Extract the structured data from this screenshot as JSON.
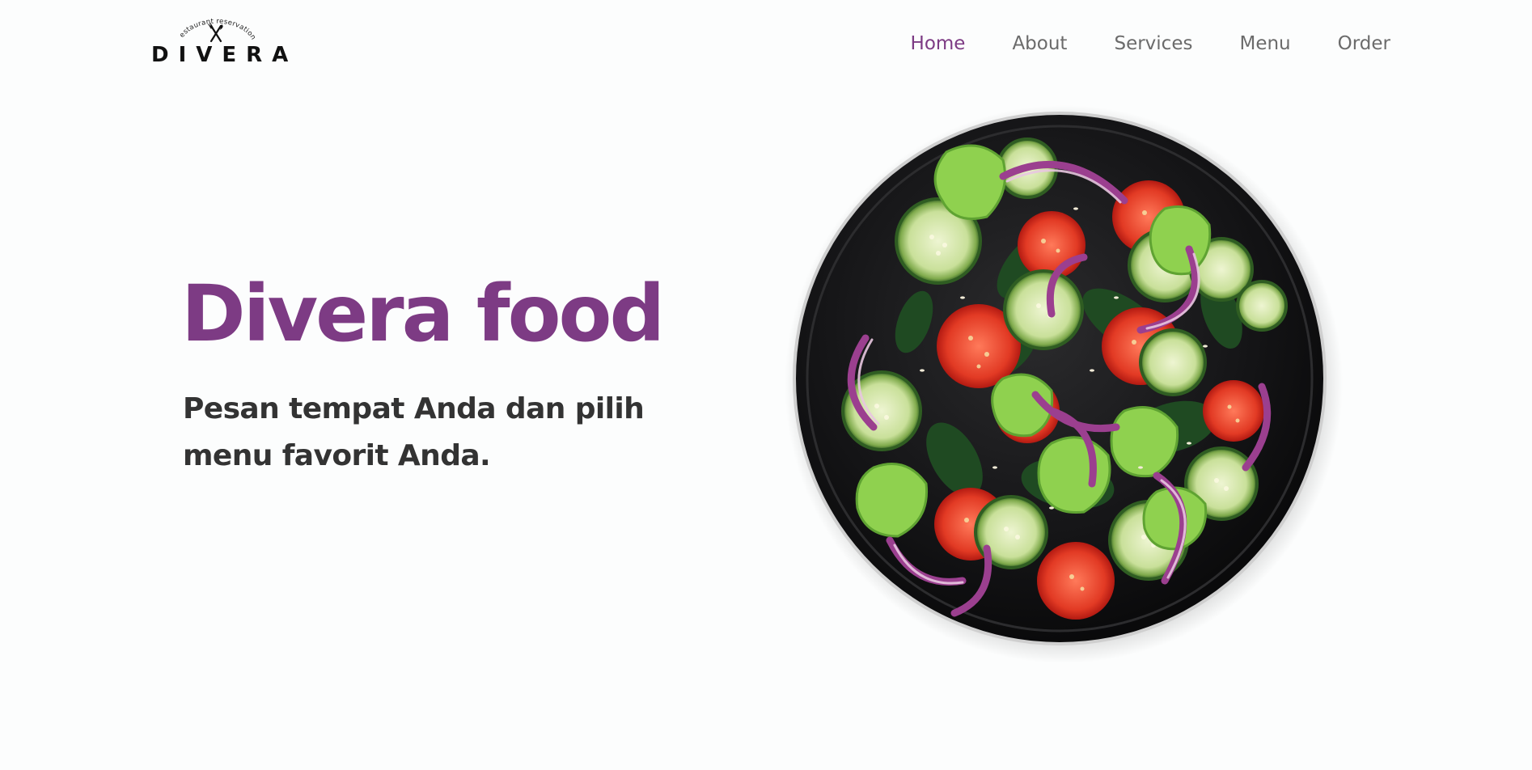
{
  "brand": {
    "name": "DIVERA",
    "tagline": "restaurant reservation"
  },
  "nav": {
    "items": [
      {
        "label": "Home",
        "active": true
      },
      {
        "label": "About",
        "active": false
      },
      {
        "label": "Services",
        "active": false
      },
      {
        "label": "Menu",
        "active": false
      },
      {
        "label": "Order",
        "active": false
      }
    ]
  },
  "hero": {
    "title": "Divera food",
    "subtitle": "Pesan tempat Anda dan pilih menu favorit Anda.",
    "image_icon": "salad-plate-image"
  },
  "colors": {
    "accent": "#7d3b84",
    "nav_text": "#6b6b6b",
    "body_text": "#333333",
    "background": "#fcfdfd"
  }
}
